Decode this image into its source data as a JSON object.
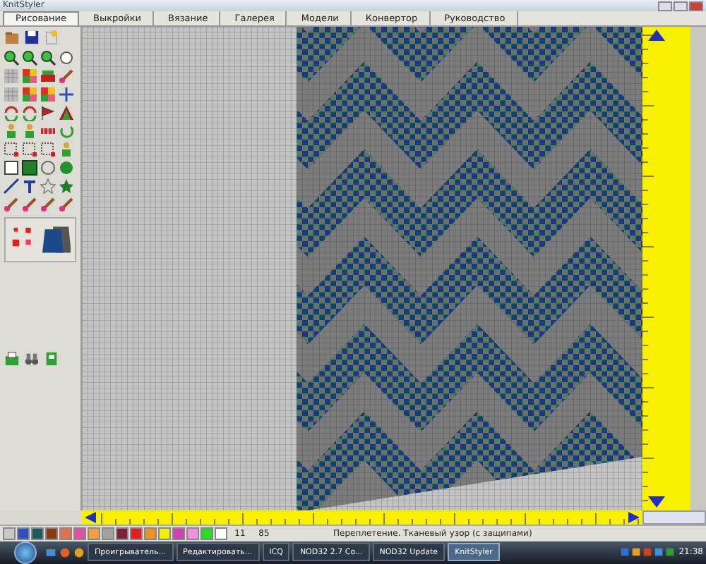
{
  "window": {
    "title": "KnitStyler"
  },
  "tabs": [
    {
      "label": "Рисование",
      "selected": true
    },
    {
      "label": "Выкройки",
      "selected": false
    },
    {
      "label": "Вязание",
      "selected": false
    },
    {
      "label": "Галерея",
      "selected": false
    },
    {
      "label": "Модели",
      "selected": false
    },
    {
      "label": "Конвертор",
      "selected": false
    },
    {
      "label": "Руководство",
      "selected": false
    }
  ],
  "palette": [
    {
      "color": "#1f5a5a"
    },
    {
      "color": "#8b3a10"
    },
    {
      "color": "#e07050"
    },
    {
      "color": "#e050a0"
    },
    {
      "color": "#f0a040"
    },
    {
      "color": "#a0a0a0"
    },
    {
      "color": "#802040"
    },
    {
      "color": "#e02020"
    },
    {
      "color": "#f09020"
    },
    {
      "color": "#f0f000"
    },
    {
      "color": "#d040b0"
    },
    {
      "color": "#f090e0"
    },
    {
      "color": "#20e020"
    },
    {
      "color": "#ffffff"
    }
  ],
  "status_bar": {
    "column": "11",
    "row": "85",
    "message": "Переплетение. Тканевый узор (с защипами)"
  },
  "taskbar": {
    "tasks": [
      {
        "label": "Проигрыватель...",
        "active": false
      },
      {
        "label": "Редактировать...",
        "active": false
      },
      {
        "label": "ICQ",
        "active": false
      },
      {
        "label": "NOD32 2.7 Co...",
        "active": false
      },
      {
        "label": "NOD32 Update",
        "active": false
      },
      {
        "label": "KnitStyler",
        "active": true
      }
    ],
    "clock": "21:38"
  }
}
